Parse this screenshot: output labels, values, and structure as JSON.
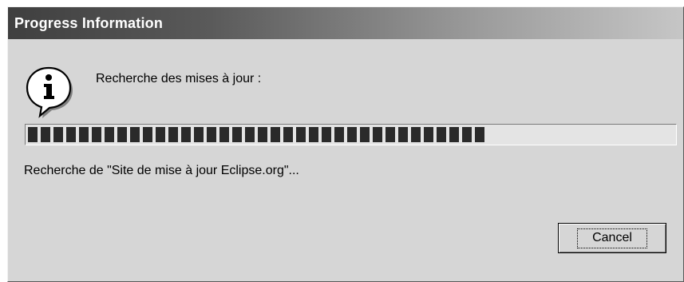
{
  "dialog": {
    "title": "Progress Information",
    "message": "Recherche des mises à jour :",
    "status": "Recherche de \"Site de mise à jour Eclipse.org\"...",
    "progress_percent": 72,
    "icon": "info-icon",
    "cancel_label": "Cancel"
  },
  "colors": {
    "title_gradient_start": "#3f3f3f",
    "title_gradient_end": "#c6c6c6",
    "dialog_background": "#d6d6d6",
    "progress_fill": "#2a2a2a"
  }
}
